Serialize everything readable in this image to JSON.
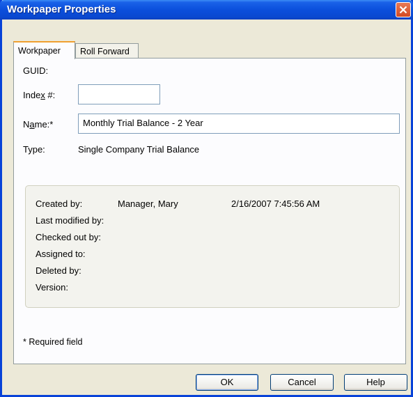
{
  "window": {
    "title": "Workpaper Properties"
  },
  "tabs": [
    {
      "label": "Workpaper",
      "active": true
    },
    {
      "label": "Roll Forward",
      "active": false
    }
  ],
  "form": {
    "guid_label": "GUID:",
    "guid_value": "",
    "index_label_pre": "Inde",
    "index_label_accel": "x",
    "index_label_post": " #:",
    "index_value": "",
    "name_label_pre": "N",
    "name_label_accel": "a",
    "name_label_post": "me:*",
    "name_value": "Monthly Trial Balance - 2 Year",
    "type_label": "Type:",
    "type_value": "Single Company Trial Balance"
  },
  "info": {
    "created_by_label": "Created by:",
    "created_by_value": "Manager, Mary",
    "created_by_date": "2/16/2007 7:45:56 AM",
    "last_modified_label": "Last modified by:",
    "checked_out_label": "Checked out by:",
    "assigned_to_label": "Assigned to:",
    "deleted_by_label": "Deleted by:",
    "version_label": "Version:"
  },
  "footer": {
    "required_note": "* Required field"
  },
  "buttons": {
    "ok": "OK",
    "cancel": "Cancel",
    "help": "Help"
  },
  "colors": {
    "titlebar": "#0b4fdc",
    "dialog_bg": "#ece9d8",
    "close_button": "#d34a22",
    "active_tab_accent": "#f0a030"
  },
  "icons": {
    "close": "close-icon"
  }
}
